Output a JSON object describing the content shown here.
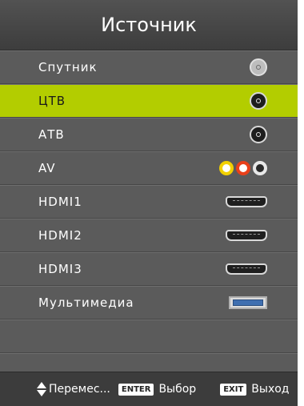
{
  "title": "Источник",
  "items": [
    {
      "label": "Спутник",
      "icon": "satellite-connector-icon"
    },
    {
      "label": "ЦТВ",
      "icon": "coax-connector-icon"
    },
    {
      "label": "АТВ",
      "icon": "coax-connector-icon"
    },
    {
      "label": "AV",
      "icon": "rca-connectors-icon"
    },
    {
      "label": "HDMI1",
      "icon": "hdmi-port-icon"
    },
    {
      "label": "HDMI2",
      "icon": "hdmi-port-icon"
    },
    {
      "label": "HDMI3",
      "icon": "hdmi-port-icon"
    },
    {
      "label": "Мультимедиа",
      "icon": "usb-port-icon"
    }
  ],
  "selected_index": 1,
  "footer": {
    "move_label": "Перемес...",
    "enter_key": "ENTER",
    "select_label": "Выбор",
    "exit_key": "EXIT",
    "exit_label": "Выход"
  },
  "colors": {
    "highlight": "#b3cd00",
    "panel": "#5b5b5b",
    "header": "#3d3d3d"
  }
}
